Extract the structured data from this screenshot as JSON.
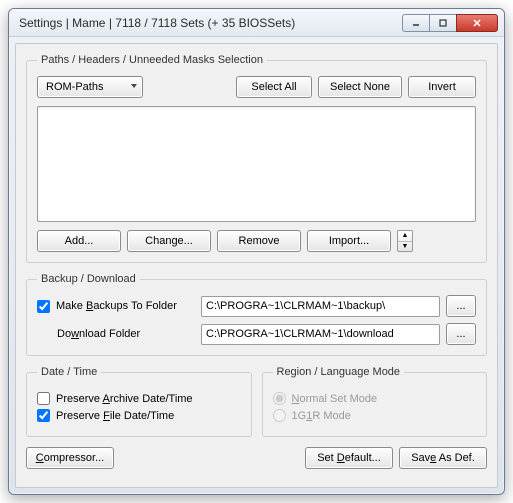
{
  "window": {
    "title": "Settings | Mame | 7118 / 7118 Sets (+ 35 BIOSSets)"
  },
  "paths": {
    "legend": "Paths / Headers / Unneeded Masks Selection",
    "dropdown_value": "ROM-Paths",
    "select_all": "Select All",
    "select_none": "Select None",
    "invert": "Invert",
    "add": "Add...",
    "change": "Change...",
    "remove": "Remove",
    "import": "Import..."
  },
  "backup": {
    "legend": "Backup / Download",
    "make_backups_pre": "Make ",
    "make_backups_u": "B",
    "make_backups_post": "ackups To Folder",
    "download_pre": "Do",
    "download_u": "w",
    "download_post": "nload Folder",
    "backup_path": "C:\\PROGRA~1\\CLRMAM~1\\backup\\",
    "download_path": "C:\\PROGRA~1\\CLRMAM~1\\download",
    "browse": "..."
  },
  "datetime": {
    "legend": "Date / Time",
    "archive_pre": "Preserve ",
    "archive_u": "A",
    "archive_post": "rchive Date/Time",
    "file_pre": "Preserve ",
    "file_u": "F",
    "file_post": "ile Date/Time"
  },
  "region": {
    "legend": "Region / Language Mode",
    "normal_u": "N",
    "normal_post": "ormal Set Mode",
    "g1r_pre": "1G",
    "g1r_u": "1",
    "g1r_post": "R Mode"
  },
  "footer": {
    "compressor_u": "C",
    "compressor_post": "ompressor...",
    "set_default_pre": "Set ",
    "set_default_u": "D",
    "set_default_post": "efault...",
    "save_as_pre": "Sav",
    "save_as_u": "e",
    "save_as_post": " As Def."
  }
}
